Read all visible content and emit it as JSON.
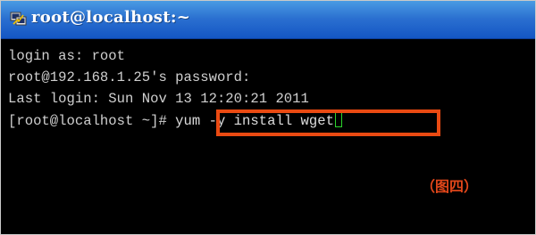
{
  "window": {
    "title": "root@localhost:~",
    "title_icon": "putty-icon",
    "title_bar_color": "#2a6fd0"
  },
  "terminal": {
    "background": "#000000",
    "lines": [
      "login as: root",
      "root@192.168.1.25's password:",
      "Last login: Sun Nov 13 12:20:21 2011"
    ],
    "prompt": "[root@localhost ~]#",
    "command": "yum -y install wget"
  },
  "annotation": {
    "highlight_color": "#ea4a12",
    "figure_label": "（图四）"
  }
}
